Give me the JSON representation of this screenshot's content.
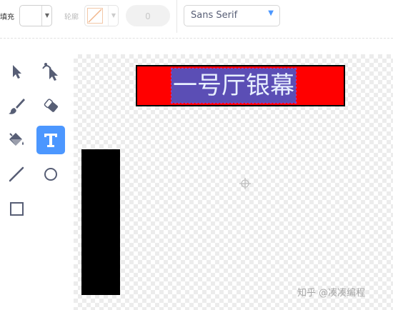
{
  "toolbar": {
    "fill_label": "填充",
    "outline_label": "轮廓",
    "outline_width_value": "0",
    "font_value": "Sans Serif"
  },
  "tools": [
    {
      "name": "select",
      "active": false
    },
    {
      "name": "reshape",
      "active": false
    },
    {
      "name": "brush",
      "active": false
    },
    {
      "name": "eraser",
      "active": false
    },
    {
      "name": "fill",
      "active": false
    },
    {
      "name": "text",
      "active": true
    },
    {
      "name": "line",
      "active": false
    },
    {
      "name": "circle",
      "active": false
    },
    {
      "name": "rectangle",
      "active": false
    }
  ],
  "canvas": {
    "banner_text": "一号厅银幕",
    "banner_color": "#ff0000",
    "text_bg_color": "#5b4eb5",
    "watermark": "知乎 @凑凑编程"
  },
  "colors": {
    "accent": "#4c97ff"
  }
}
